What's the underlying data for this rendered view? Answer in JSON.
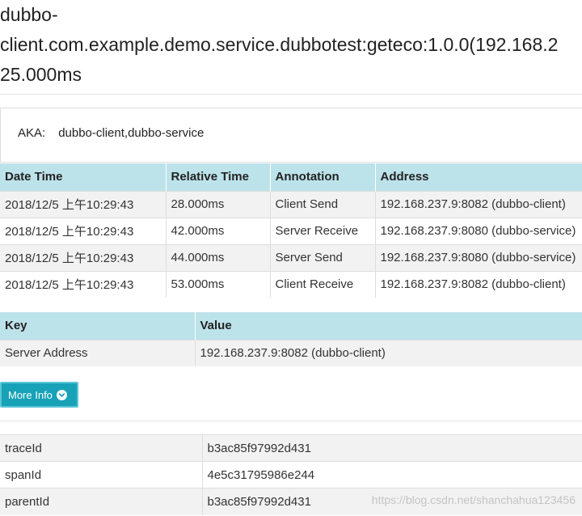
{
  "header": {
    "title_lines": [
      "dubbo-",
      "client.com.example.demo.service.dubbotest:geteco:1.0.0(192.168.2",
      "25.000ms"
    ]
  },
  "aka": {
    "label": "AKA:",
    "value": "dubbo-client,dubbo-service"
  },
  "annotations_table": {
    "headers": [
      "Date Time",
      "Relative Time",
      "Annotation",
      "Address"
    ],
    "rows": [
      [
        "2018/12/5 上午10:29:43",
        "28.000ms",
        "Client Send",
        "192.168.237.9:8082 (dubbo-client)"
      ],
      [
        "2018/12/5 上午10:29:43",
        "42.000ms",
        "Server Receive",
        "192.168.237.9:8080 (dubbo-service)"
      ],
      [
        "2018/12/5 上午10:29:43",
        "44.000ms",
        "Server Send",
        "192.168.237.9:8080 (dubbo-service)"
      ],
      [
        "2018/12/5 上午10:29:43",
        "53.000ms",
        "Client Receive",
        "192.168.237.9:8082 (dubbo-client)"
      ]
    ]
  },
  "binary_table": {
    "headers": [
      "Key",
      "Value"
    ],
    "rows": [
      [
        "Server Address",
        "192.168.237.9:8082 (dubbo-client)"
      ]
    ]
  },
  "more_info_button": {
    "label": "More Info",
    "icon": "chevron-circle-down-icon"
  },
  "ids_table": {
    "rows": [
      [
        "traceId",
        "b3ac85f97992d431"
      ],
      [
        "spanId",
        "4e5c31795986e244"
      ],
      [
        "parentId",
        "b3ac85f97992d431"
      ]
    ]
  },
  "watermark": "https://blog.csdn.net/shanchahua123456",
  "colors": {
    "header_bg": "#bde3ea",
    "button_bg": "#17a2b8",
    "stripe_bg": "#f2f2f2"
  }
}
